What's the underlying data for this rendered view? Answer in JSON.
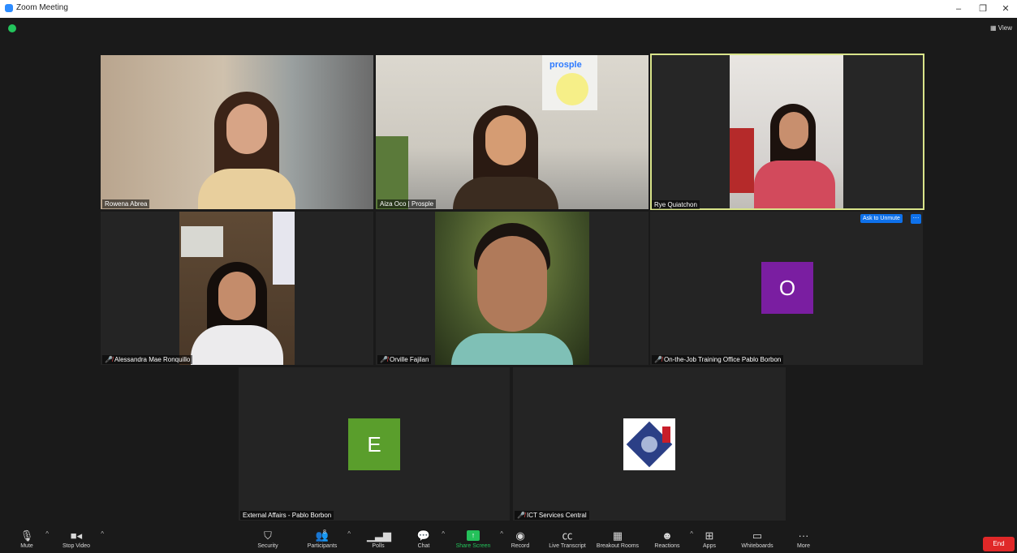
{
  "window": {
    "title": "Zoom Meeting",
    "min": "–",
    "restore": "❐",
    "close": "✕"
  },
  "view_label": "View",
  "participants": [
    {
      "name": "Rowena Abrea"
    },
    {
      "name": "Aiza Oco | Prosple",
      "brand": "prosple"
    },
    {
      "name": "Rye Quiatchon"
    },
    {
      "name": "Alessandra Mae Ronquillo"
    },
    {
      "name": "Orville Fajilan"
    },
    {
      "name": "On-the-Job Training Office Pablo Borbon",
      "initial": "O",
      "color": "#7a1ea1"
    },
    {
      "name": "External Affairs - Pablo Borbon",
      "initial": "E",
      "color": "#5a9e2c"
    },
    {
      "name": "ICT Services Central"
    }
  ],
  "unmute": {
    "label": "Ask to Unmute",
    "more": "···"
  },
  "toolbar": {
    "mute": "Mute",
    "video": "Stop Video",
    "security": "Security",
    "participants": "Participants",
    "participants_count": "8",
    "polls": "Polls",
    "chat": "Chat",
    "share": "Share Screen",
    "record": "Record",
    "transcript": "Live Transcript",
    "breakout": "Breakout Rooms",
    "reactions": "Reactions",
    "apps": "Apps",
    "whiteboards": "Whiteboards",
    "more": "More",
    "end": "End"
  }
}
